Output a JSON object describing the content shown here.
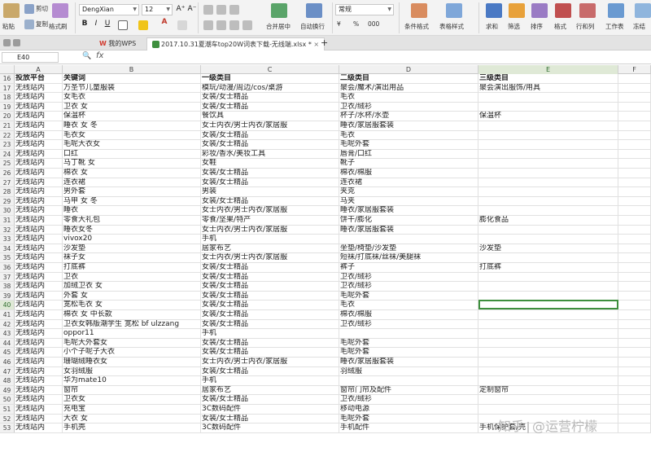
{
  "ribbon": {
    "clipboard": {
      "paste": "粘贴",
      "cut": "剪切",
      "copy": "复制",
      "format_painter": "格式刷"
    },
    "font": {
      "name": "DengXian",
      "size": "12",
      "grow": "A⁺",
      "shrink": "A⁻",
      "bold": "B",
      "italic": "I",
      "underline": "U",
      "color_letter": "A"
    },
    "align": {
      "merge_center": "合并居中",
      "wrap_text": "自动换行"
    },
    "number": {
      "format": "常规",
      "currency": "¥",
      "percent": "%",
      "thousands": "000"
    },
    "styles": {
      "conditional": "条件格式",
      "table_style": "表格样式"
    },
    "editing": {
      "sum": "求和",
      "filter": "筛选",
      "sort": "排序",
      "format": "格式",
      "rows_cols": "行和列",
      "worksheet": "工作表",
      "freeze": "冻结"
    }
  },
  "tabs": {
    "my_wps": "我的WPS",
    "file": "2017.10.31夏潮车top20W词表下载-无线端.xlsx *",
    "add": "+"
  },
  "formula_bar": {
    "cell_ref": "E40",
    "fx": "fx",
    "value": ""
  },
  "columns": [
    "A",
    "B",
    "C",
    "D",
    "E",
    "F"
  ],
  "selected_column": "E",
  "selected_row": "40",
  "rows": [
    {
      "n": "16",
      "a": "投放平台",
      "b": "关键词",
      "c": "一级类目",
      "d": "二级类目",
      "e": "三级类目",
      "hdr": true
    },
    {
      "n": "17",
      "a": "无线站内",
      "b": "万圣节儿童服装",
      "c": "模玩/动漫/周边/cos/桌游",
      "d": "聚会/魔术/演出用品",
      "e": "聚会演出服饰/用具"
    },
    {
      "n": "18",
      "a": "无线站内",
      "b": "女毛衣",
      "c": "女装/女士精品",
      "d": "毛衣",
      "e": ""
    },
    {
      "n": "19",
      "a": "无线站内",
      "b": "卫衣 女",
      "c": "女装/女士精品",
      "d": "卫衣/绒衫",
      "e": ""
    },
    {
      "n": "20",
      "a": "无线站内",
      "b": "保温杯",
      "c": "餐饮具",
      "d": "杯子/水杯/水壶",
      "e": "保温杯"
    },
    {
      "n": "21",
      "a": "无线站内",
      "b": "睡衣 女 冬",
      "c": "女士内衣/男士内衣/家居服",
      "d": "睡衣/家居服套装",
      "e": ""
    },
    {
      "n": "22",
      "a": "无线站内",
      "b": "毛衣女",
      "c": "女装/女士精品",
      "d": "毛衣",
      "e": ""
    },
    {
      "n": "23",
      "a": "无线站内",
      "b": "毛呢大衣女",
      "c": "女装/女士精品",
      "d": "毛呢外套",
      "e": ""
    },
    {
      "n": "24",
      "a": "无线站内",
      "b": "口红",
      "c": "彩妆/香水/美妆工具",
      "d": "唇膏/口红",
      "e": ""
    },
    {
      "n": "25",
      "a": "无线站内",
      "b": "马丁靴 女",
      "c": "女鞋",
      "d": "靴子",
      "e": ""
    },
    {
      "n": "26",
      "a": "无线站内",
      "b": "棉衣 女",
      "c": "女装/女士精品",
      "d": "棉衣/棉服",
      "e": ""
    },
    {
      "n": "27",
      "a": "无线站内",
      "b": "连衣裙",
      "c": "女装/女士精品",
      "d": "连衣裙",
      "e": ""
    },
    {
      "n": "28",
      "a": "无线站内",
      "b": "男外套",
      "c": "男装",
      "d": "夹克",
      "e": ""
    },
    {
      "n": "29",
      "a": "无线站内",
      "b": "马甲 女 冬",
      "c": "女装/女士精品",
      "d": "马夹",
      "e": ""
    },
    {
      "n": "30",
      "a": "无线站内",
      "b": "睡衣",
      "c": "女士内衣/男士内衣/家居服",
      "d": "睡衣/家居服套装",
      "e": ""
    },
    {
      "n": "31",
      "a": "无线站内",
      "b": "零食大礼包",
      "c": "零食/坚果/特产",
      "d": "饼干/膨化",
      "e": "膨化食品"
    },
    {
      "n": "32",
      "a": "无线站内",
      "b": "睡衣女冬",
      "c": "女士内衣/男士内衣/家居服",
      "d": "睡衣/家居服套装",
      "e": ""
    },
    {
      "n": "33",
      "a": "无线站内",
      "b": "vivox20",
      "c": "手机",
      "d": "",
      "e": ""
    },
    {
      "n": "34",
      "a": "无线站内",
      "b": "沙发垫",
      "c": "居家布艺",
      "d": "坐垫/椅垫/沙发垫",
      "e": "沙发垫"
    },
    {
      "n": "35",
      "a": "无线站内",
      "b": "袜子女",
      "c": "女士内衣/男士内衣/家居服",
      "d": "短袜/打底袜/丝袜/美腿袜",
      "e": ""
    },
    {
      "n": "36",
      "a": "无线站内",
      "b": "打底裤",
      "c": "女装/女士精品",
      "d": "裤子",
      "e": "打底裤"
    },
    {
      "n": "37",
      "a": "无线站内",
      "b": "卫衣",
      "c": "女装/女士精品",
      "d": "卫衣/绒衫",
      "e": ""
    },
    {
      "n": "38",
      "a": "无线站内",
      "b": "加绒卫衣 女",
      "c": "女装/女士精品",
      "d": "卫衣/绒衫",
      "e": ""
    },
    {
      "n": "39",
      "a": "无线站内",
      "b": "外套 女",
      "c": "女装/女士精品",
      "d": "毛呢外套",
      "e": ""
    },
    {
      "n": "40",
      "a": "无线站内",
      "b": "宽松毛衣 女",
      "c": "女装/女士精品",
      "d": "毛衣",
      "e": ""
    },
    {
      "n": "41",
      "a": "无线站内",
      "b": "棉衣 女 中长款",
      "c": "女装/女士精品",
      "d": "棉衣/棉服",
      "e": ""
    },
    {
      "n": "42",
      "a": "无线站内",
      "b": "卫衣女韩版潮学生 宽松 bf ulzzang",
      "c": "女装/女士精品",
      "d": "卫衣/绒衫",
      "e": ""
    },
    {
      "n": "43",
      "a": "无线站内",
      "b": "oppor11",
      "c": "手机",
      "d": "",
      "e": ""
    },
    {
      "n": "44",
      "a": "无线站内",
      "b": "毛呢大外套女",
      "c": "女装/女士精品",
      "d": "毛呢外套",
      "e": ""
    },
    {
      "n": "45",
      "a": "无线站内",
      "b": "小个子呢子大衣",
      "c": "女装/女士精品",
      "d": "毛呢外套",
      "e": ""
    },
    {
      "n": "46",
      "a": "无线站内",
      "b": "珊瑚绒睡衣女",
      "c": "女士内衣/男士内衣/家居服",
      "d": "睡衣/家居服套装",
      "e": ""
    },
    {
      "n": "47",
      "a": "无线站内",
      "b": "女羽绒服",
      "c": "女装/女士精品",
      "d": "羽绒服",
      "e": ""
    },
    {
      "n": "48",
      "a": "无线站内",
      "b": "华为mate10",
      "c": "手机",
      "d": "",
      "e": ""
    },
    {
      "n": "49",
      "a": "无线站内",
      "b": "窗帘",
      "c": "居家布艺",
      "d": "窗帘门帘及配件",
      "e": "定制窗帘"
    },
    {
      "n": "50",
      "a": "无线站内",
      "b": "卫衣女",
      "c": "女装/女士精品",
      "d": "卫衣/绒衫",
      "e": ""
    },
    {
      "n": "51",
      "a": "无线站内",
      "b": "充电宝",
      "c": "3C数码配件",
      "d": "移动电源",
      "e": ""
    },
    {
      "n": "52",
      "a": "无线站内",
      "b": "大衣 女",
      "c": "女装/女士精品",
      "d": "毛呢外套",
      "e": ""
    },
    {
      "n": "53",
      "a": "无线站内",
      "b": "手机壳",
      "c": "3C数码配件",
      "d": "手机配件",
      "e": "手机保护套/壳"
    }
  ],
  "watermark": {
    "brand": "知乎",
    "handle": "@运营柠檬"
  },
  "colors": {
    "accent": "#3e8f3e",
    "ribbon_bg": "#f3f3f3"
  }
}
